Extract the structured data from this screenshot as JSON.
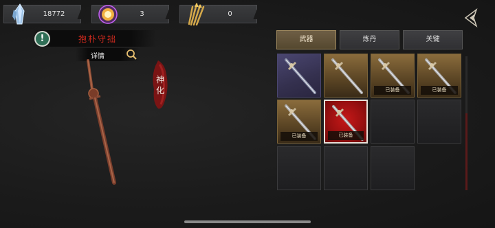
{
  "resources": [
    {
      "icon": "crystal-icon",
      "value": "18772"
    },
    {
      "icon": "glowing-orb-icon",
      "value": "3"
    },
    {
      "icon": "arrows-bundle-icon",
      "value": "0"
    }
  ],
  "weapon": {
    "name": "抱朴守拙",
    "detail_label": "详情",
    "evolve_label": "神化"
  },
  "tabs": [
    {
      "label": "武器",
      "active": true
    },
    {
      "label": "炼丹",
      "active": false
    },
    {
      "label": "关键",
      "active": false
    }
  ],
  "inventory": {
    "equipped_label": "已装备",
    "slots": [
      {
        "rarity": "purple",
        "item": "sword",
        "equipped": false
      },
      {
        "rarity": "gold",
        "item": "sword",
        "equipped": false
      },
      {
        "rarity": "gold",
        "item": "sword",
        "equipped": true
      },
      {
        "rarity": "gold",
        "item": "sword",
        "equipped": true
      },
      {
        "rarity": "gold",
        "item": "sword",
        "equipped": true
      },
      {
        "rarity": "red",
        "item": "sword",
        "equipped": true,
        "selected": true
      },
      {
        "rarity": "empty"
      },
      {
        "rarity": "empty"
      },
      {
        "rarity": "empty"
      },
      {
        "rarity": "empty"
      },
      {
        "rarity": "empty"
      }
    ]
  },
  "colors": {
    "title_red": "#d22a1e",
    "tab_active": "#6e5e45",
    "slot_gold": "#8a6c3c",
    "slot_red": "#c41818"
  }
}
